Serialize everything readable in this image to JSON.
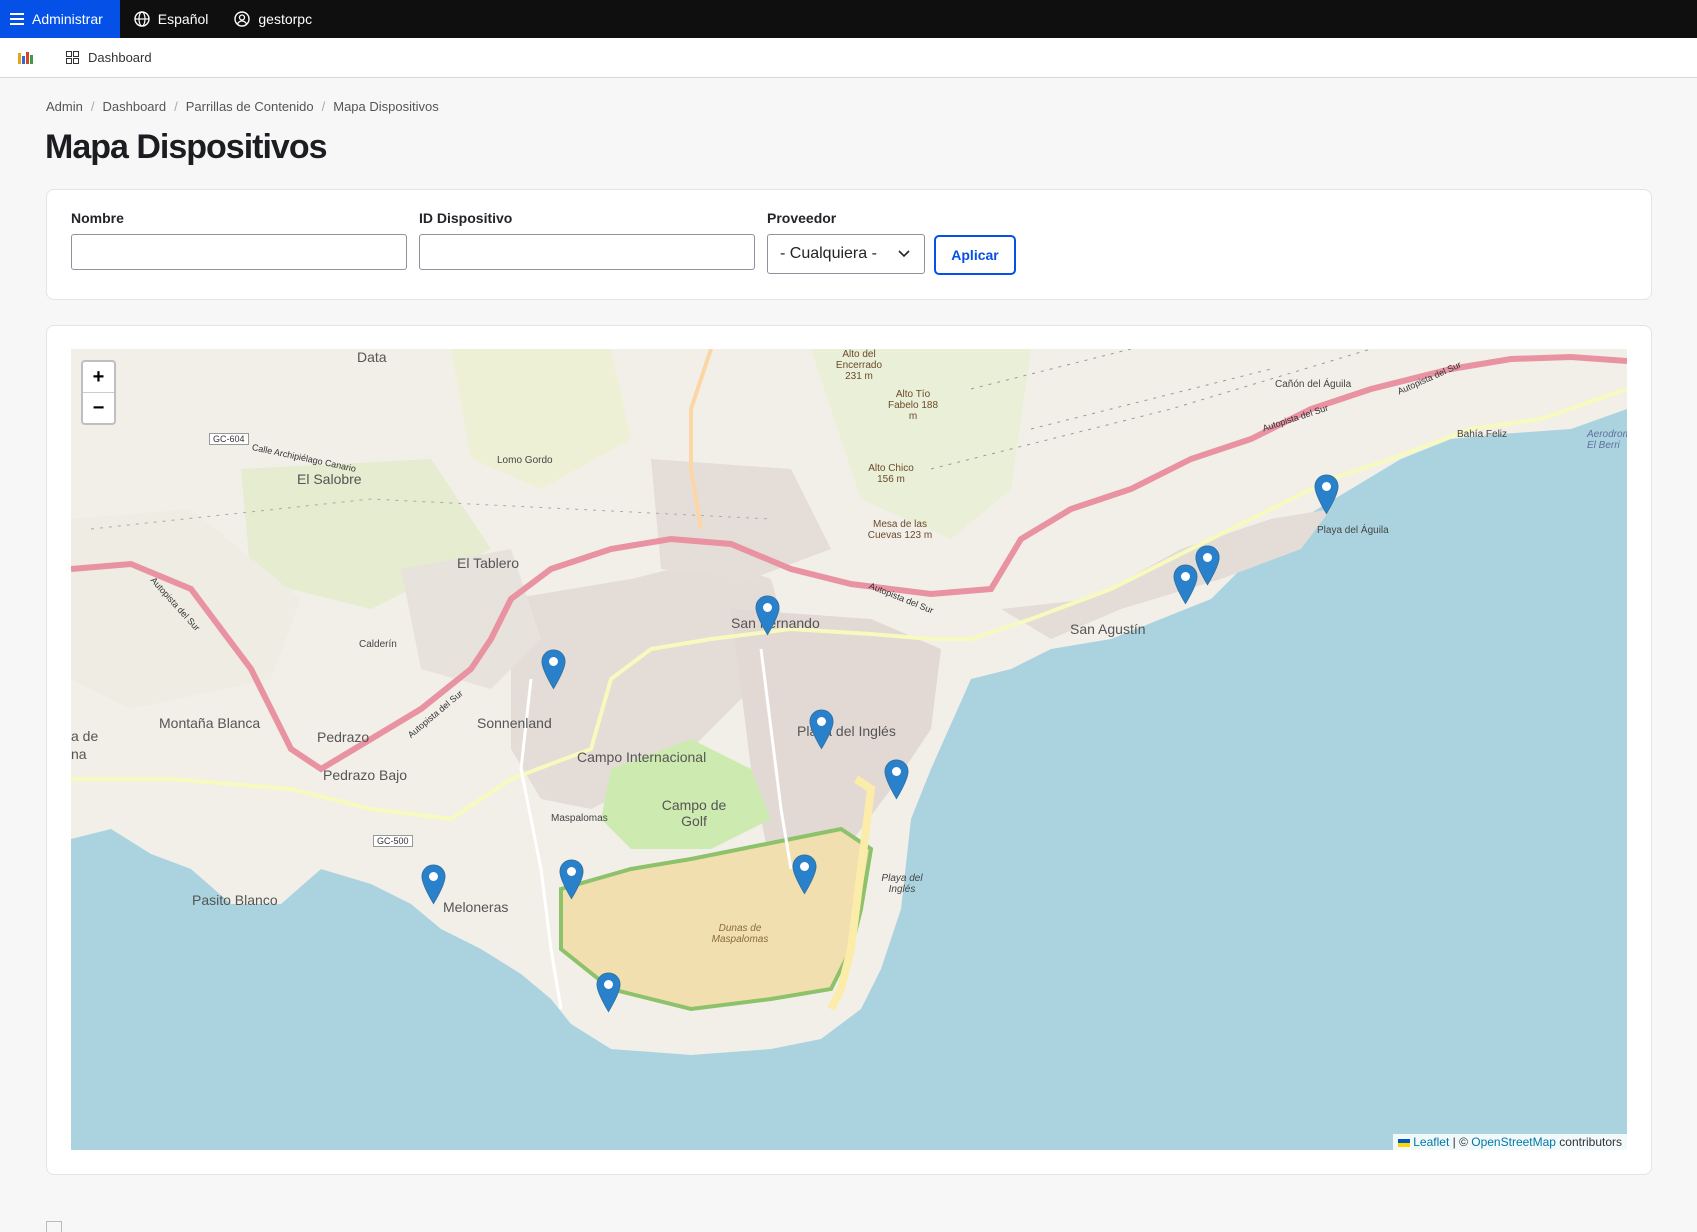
{
  "topbar": {
    "admin_label": "Administrar",
    "language_label": "Español",
    "user_label": "gestorpc"
  },
  "subbar": {
    "dashboard_label": "Dashboard"
  },
  "breadcrumb": [
    "Admin",
    "Dashboard",
    "Parrillas de Contenido",
    "Mapa Dispositivos"
  ],
  "page_title": "Mapa Dispositivos",
  "filters": {
    "name_label": "Nombre",
    "name_value": "",
    "device_id_label": "ID Dispositivo",
    "device_id_value": "",
    "provider_label": "Proveedor",
    "provider_selected": "- Cualquiera -",
    "apply_label": "Aplicar"
  },
  "map": {
    "zoom_in": "+",
    "zoom_out": "−",
    "attribution_leaflet": "Leaflet",
    "attribution_sep": " | © ",
    "attribution_osm": "OpenStreetMap",
    "attribution_contrib": " contributors",
    "marker_color": "#2a81cb",
    "sea_color": "#aad3df",
    "labels": {
      "el_salobre": "El Salobre",
      "el_tablero": "El Tablero",
      "san_fernando": "San Fernando",
      "san_agustin": "San Agustín",
      "sonnenland": "Sonnenland",
      "campo_internacional": "Campo Internacional",
      "campo_de_golf": "Campo de Golf",
      "maspalomas": "Maspalomas",
      "playa_del_ingles": "Playa del Inglés",
      "montana_blanca": "Montaña Blanca",
      "pedrazo": "Pedrazo",
      "pedrazo_bajo": "Pedrazo Bajo",
      "pasito_blanco": "Pasito Blanco",
      "meloneras": "Meloneras",
      "dunas": "Dunas de Maspalomas",
      "playa_del_aguila": "Playa del Águila",
      "canon_del_aguila": "Cañón del Águila",
      "bahia_feliz": "Bahía Feliz",
      "lomo_gordo": "Lomo Gordo",
      "calderin": "Calderín",
      "alto_tio_fabelo": "Alto Tío Fabelo 188 m",
      "alto_chico": "Alto Chico 156 m",
      "mesa_cuevas": "Mesa de las Cuevas 123 m",
      "alto_encerrado": "Alto del Encerrado 231 m",
      "autopista": "Autopista del Sur",
      "gc604": "GC-604",
      "gc500": "GC-500",
      "playa_ingles_beach": "Playa del Inglés",
      "data": "Data",
      "calle_arch": "Calle Archipiélago Canario",
      "la_de_na": "a de na",
      "aerodrome": "Aerodrom El Berri"
    },
    "marker_count": 12
  }
}
